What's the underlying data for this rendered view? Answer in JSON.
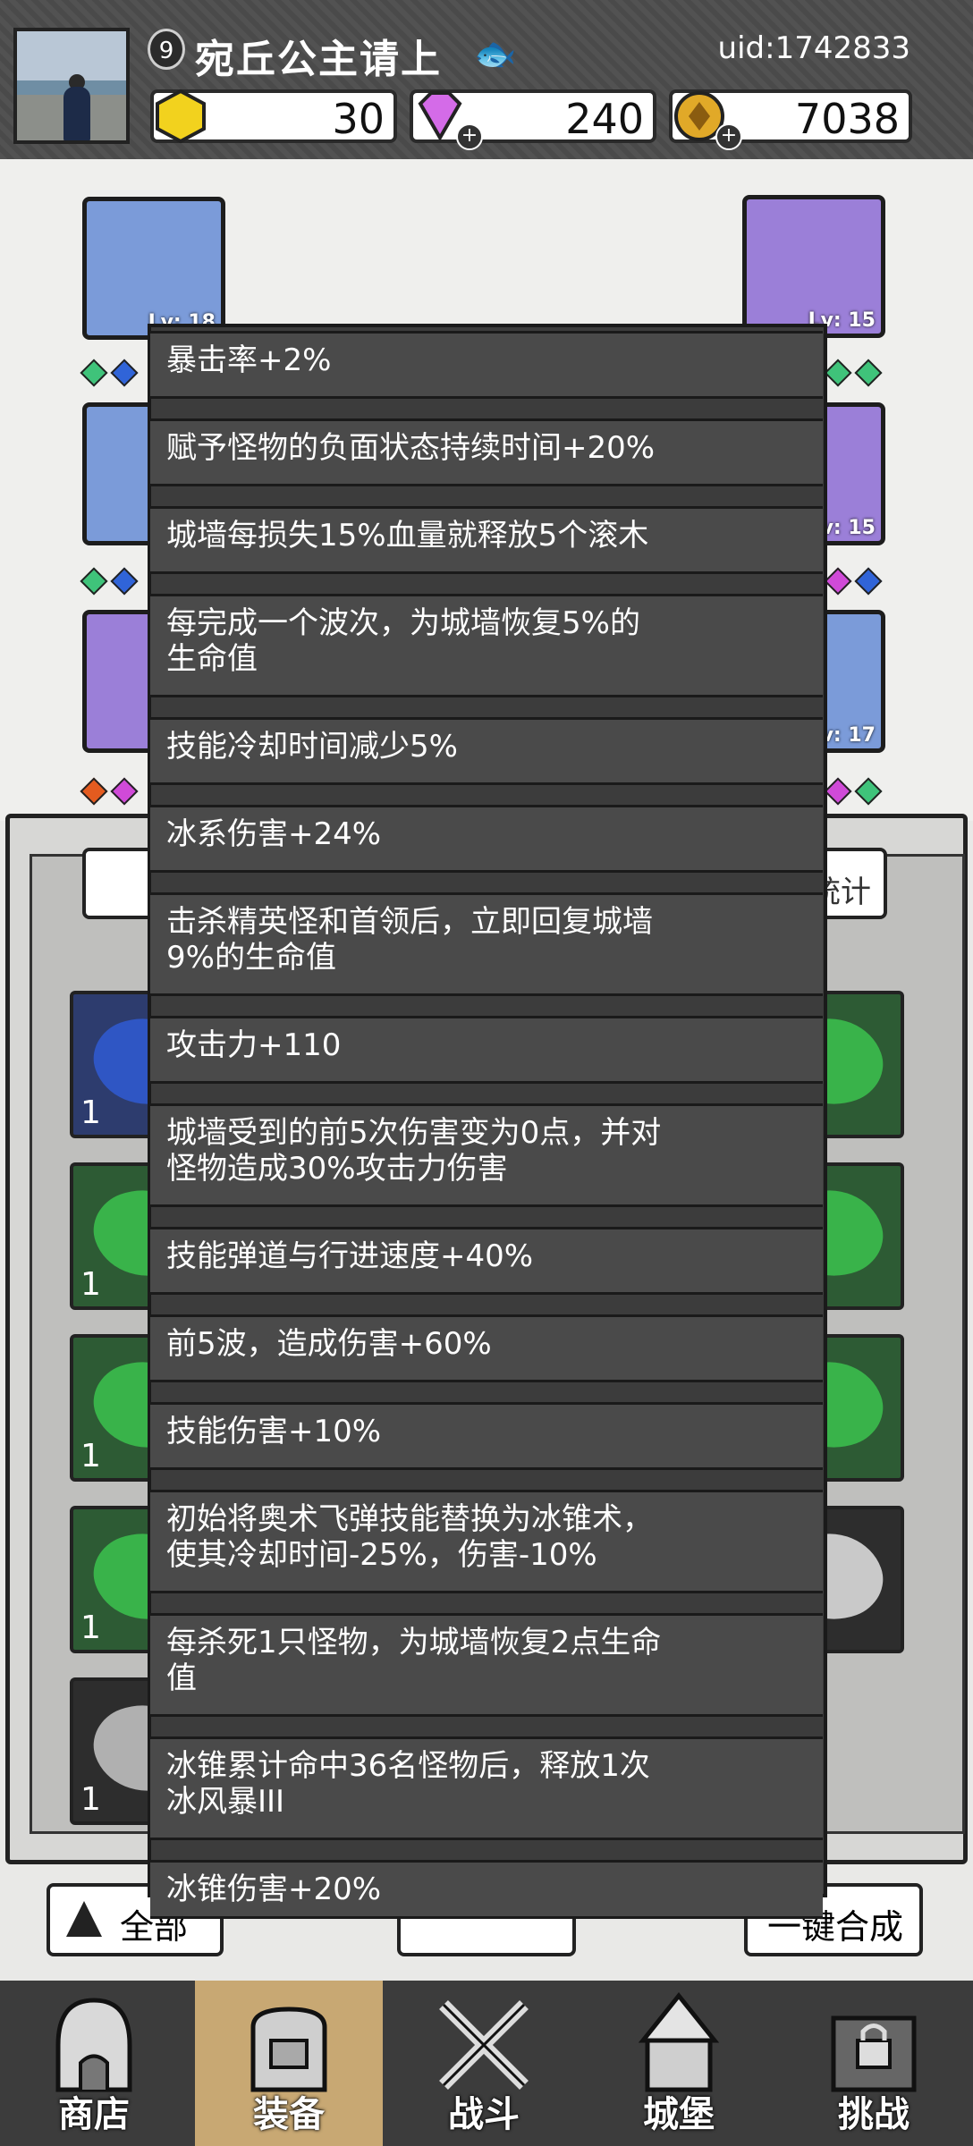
{
  "header": {
    "level": "9",
    "username": "宛丘公主请上",
    "uid": "uid:1742833",
    "currencies": [
      {
        "name": "gold-crystal",
        "value": "30"
      },
      {
        "name": "gem",
        "value": "240"
      },
      {
        "name": "coin",
        "value": "7038"
      }
    ]
  },
  "equipment_slots": [
    {
      "lv": "Lv: 18"
    },
    {
      "lv": "Lv: 15"
    },
    {
      "lv": "Lv: 15"
    },
    {
      "lv": "Lv: 17"
    }
  ],
  "inventory": {
    "filter_label": "全部",
    "merge_label": "一键合成",
    "stats_label": "属性统计",
    "item_count": "1"
  },
  "bonuses": [
    "暴击率+2%",
    "赋予怪物的负面状态持续时间+20%",
    "城墙每损失15%血量就释放5个滚木",
    "每完成一个波次，为城墙恢复5%的\n生命值",
    "技能冷却时间减少5%",
    "冰系伤害+24%",
    "击杀精英怪和首领后，立即回复城墙\n9%的生命值",
    "攻击力+110",
    "城墙受到的前5次伤害变为0点，并对\n怪物造成30%攻击力伤害",
    "技能弹道与行进速度+40%",
    "前5波，造成伤害+60%",
    "技能伤害+10%",
    "初始将奥术飞弹技能替换为冰锥术，\n使其冷却时间-25%，伤害-10%",
    "每杀死1只怪物，为城墙恢复2点生命\n值",
    "冰锥累计命中36名怪物后，释放1次\n冰风暴III",
    "冰锥伤害+20%"
  ],
  "nav": [
    {
      "label": "商店",
      "icon": "shop-icon"
    },
    {
      "label": "装备",
      "icon": "backpack-icon"
    },
    {
      "label": "战斗",
      "icon": "crossed-swords-icon"
    },
    {
      "label": "城堡",
      "icon": "castle-icon"
    },
    {
      "label": "挑战",
      "icon": "locked-challenge-icon"
    }
  ],
  "colors": {
    "tooltip_bg": "#3c3c3c",
    "nav_active": "#c8a873",
    "header_bg": "#4c4c4c"
  }
}
